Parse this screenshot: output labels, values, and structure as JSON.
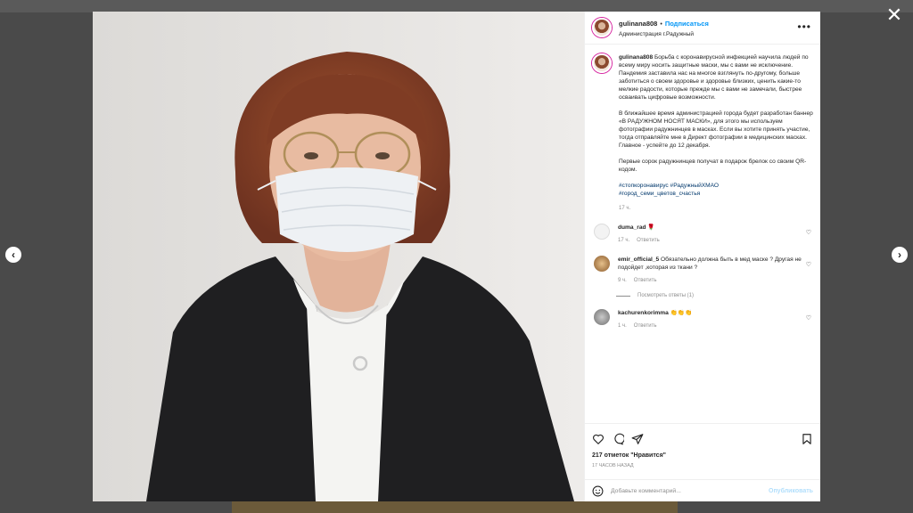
{
  "post": {
    "username": "gulinana808",
    "follow_label": "Подписаться",
    "separator": "•",
    "location": "Администрация г.Радужный",
    "more_icon": "more-dots-icon"
  },
  "caption": {
    "username": "gulinana808",
    "paragraph1": "Борьба с коронавирусной инфекцией научила людей по всему миру носить защитные маски, мы с вами не исключение. Пандемия заставила нас на многое взглянуть по-другому, больше заботиться о своем здоровье и здоровье близких, ценить какие-то мелкие радости, которые прежде мы с вами не замечали, быстрее осваивать цифровые возможности.",
    "paragraph2": "В ближайшее время администрацией города будет разработан баннер «В РАДУЖНОМ НОСЯТ МАСКИ», для этого мы используем фотографии радужнинцев в масках. Если вы хотите принять участие, тогда отправляйте мне в Директ фотографии в медицинских масках. Главное - успейте до 12 декабря.",
    "paragraph3": "Первые сорок радужнинцев получат в подарок брелок со своим QR-кодом.",
    "hashtags_line1": "#стопкоронавирус #РадужныйХМАО",
    "hashtags_line2": "#город_семи_цветов_счастья",
    "time": "17 ч."
  },
  "comments": [
    {
      "username": "duma_rad",
      "text": "🌹",
      "time": "17 ч.",
      "reply_label": "Ответить"
    },
    {
      "username": "emir_official_5",
      "text": "Обязательно должна быть в мед маске ? Другая не подойдет ,которая из ткани ?",
      "time": "9 ч.",
      "reply_label": "Ответить",
      "view_replies": "Посмотреть ответы (1)"
    },
    {
      "username": "kachurenkorimma",
      "text": "👏👏👏",
      "time": "1 ч.",
      "reply_label": "Ответить"
    }
  ],
  "actions": {
    "likes": "217 отметок \"Нравится\"",
    "posted_ago": "17 часов назад"
  },
  "add_comment": {
    "placeholder": "Добавьте комментарий...",
    "post_label": "Опубликовать"
  },
  "colors": {
    "accent": "#0095f6",
    "hashtag": "#00376b",
    "muted": "#8e8e8e",
    "text": "#262626"
  }
}
